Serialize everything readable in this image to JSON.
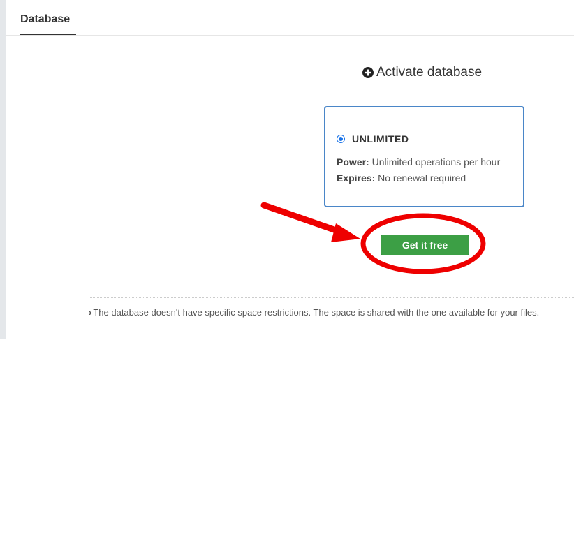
{
  "tabs": {
    "active_label": "Database"
  },
  "activate": {
    "title": "Activate database",
    "icon": "plus-circle-icon"
  },
  "plan": {
    "selected": true,
    "name": "UNLIMITED",
    "power_label": "Power:",
    "power_value": "Unlimited operations per hour",
    "expires_label": "Expires:",
    "expires_value": "No renewal required",
    "border_color": "#4a86c8"
  },
  "cta": {
    "label": "Get it free",
    "color": "#3c9f45"
  },
  "annotation": {
    "color": "#ee0000",
    "shapes": [
      "arrow",
      "circle"
    ]
  },
  "footnote": {
    "icon": "chevron-right-icon",
    "text": "The database doesn't have specific space restrictions. The space is shared with the one available for your files."
  }
}
